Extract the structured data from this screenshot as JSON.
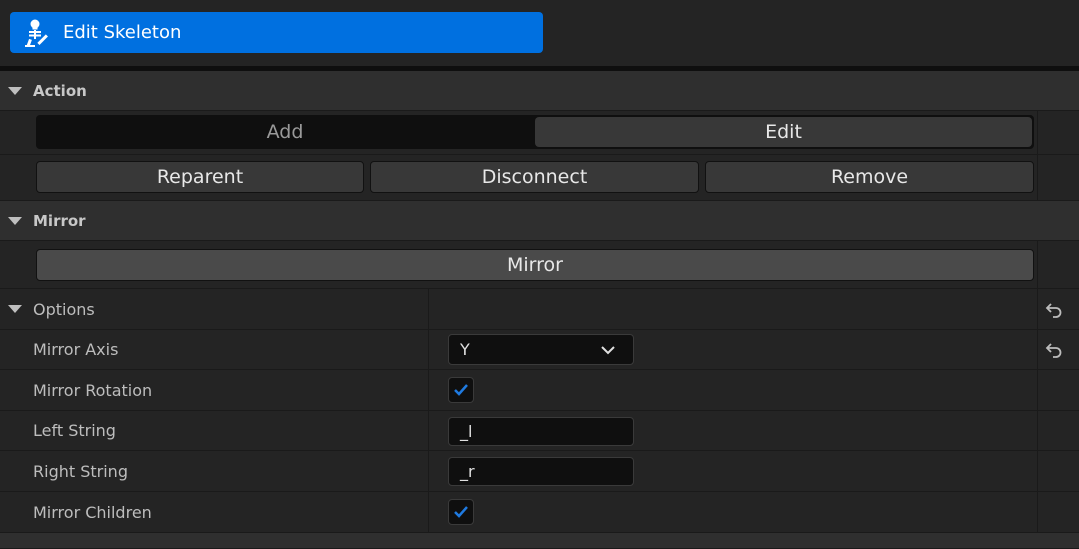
{
  "toolbar": {
    "mode_label": "Edit Skeleton",
    "mode_icon": "skeleton-edit-icon",
    "accent_color": "#0070e0"
  },
  "action": {
    "title": "Action",
    "tabs": [
      {
        "label": "Add",
        "selected": false
      },
      {
        "label": "Edit",
        "selected": true
      }
    ],
    "buttons": [
      "Reparent",
      "Disconnect",
      "Remove"
    ]
  },
  "mirror": {
    "title": "Mirror",
    "button_label": "Mirror"
  },
  "options": {
    "title": "Options",
    "mirror_axis": {
      "label": "Mirror Axis",
      "value": "Y"
    },
    "mirror_rotation": {
      "label": "Mirror Rotation",
      "checked": true
    },
    "left_string": {
      "label": "Left String",
      "value": "_l"
    },
    "right_string": {
      "label": "Right String",
      "value": "_r"
    },
    "mirror_children": {
      "label": "Mirror Children",
      "checked": true
    }
  }
}
